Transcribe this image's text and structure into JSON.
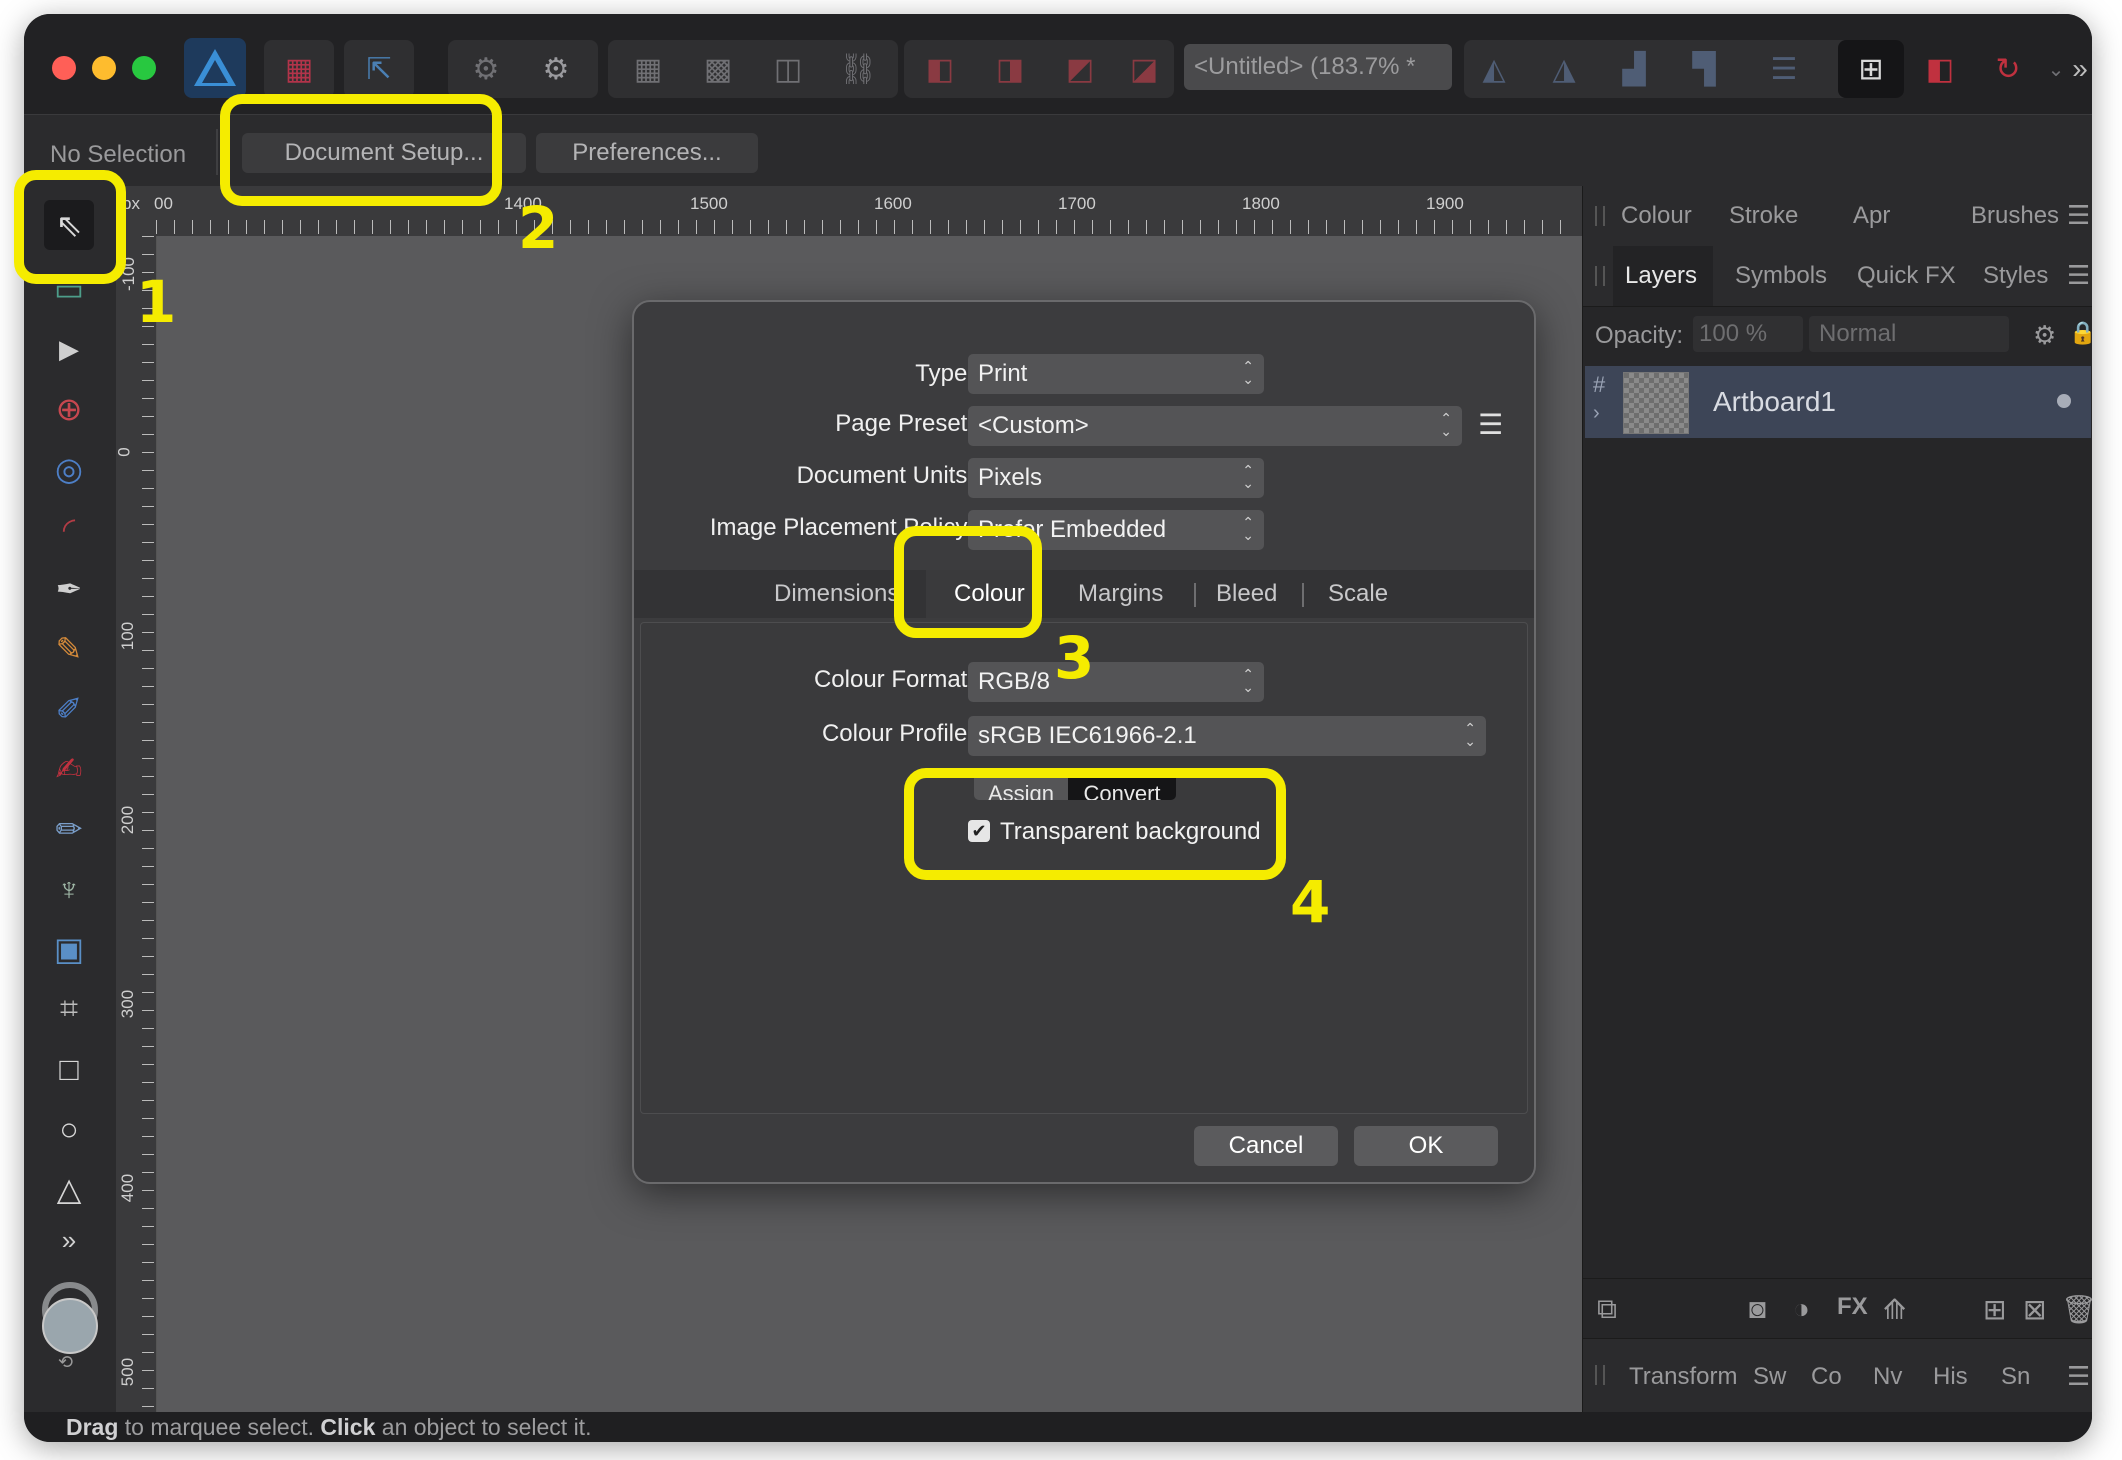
{
  "window": {
    "document_title": "<Untitled> (183.7% *"
  },
  "context_toolbar": {
    "selection_status": "No Selection",
    "document_setup_label": "Document Setup...",
    "preferences_label": "Preferences..."
  },
  "rulers": {
    "unit": "px",
    "horizontal_ticks": [
      "00",
      "1400",
      "1500",
      "1600",
      "1700",
      "1800",
      "1900"
    ],
    "vertical_ticks": [
      "-100",
      "0",
      "100",
      "200",
      "300",
      "400",
      "500"
    ]
  },
  "right_panel": {
    "top_tabs": [
      "Colour",
      "Stroke",
      "Apr",
      "Brushes"
    ],
    "studio_tabs": [
      "Layers",
      "Symbols",
      "Quick FX",
      "Styles"
    ],
    "active_studio_tab": "Layers",
    "opacity_label": "Opacity:",
    "opacity_value": "100 %",
    "blend_mode": "Normal",
    "layer_name": "Artboard1",
    "bottom_tabs": [
      "Transform",
      "Sw",
      "Co",
      "Nv",
      "His",
      "Sn"
    ]
  },
  "dialog": {
    "type_label": "Type:",
    "type_value": "Print",
    "page_preset_label": "Page Preset:",
    "page_preset_value": "<Custom>",
    "document_units_label": "Document Units:",
    "document_units_value": "Pixels",
    "image_placement_label": "Image Placement Policy:",
    "image_placement_value": "Prefer Embedded",
    "tabs": [
      "Dimensions",
      "Colour",
      "Margins",
      "Bleed",
      "Scale"
    ],
    "active_tab": "Colour",
    "colour_format_label": "Colour Format:",
    "colour_format_value": "RGB/8",
    "colour_profile_label": "Colour Profile:",
    "colour_profile_value": "sRGB IEC61966-2.1",
    "assign_label": "Assign",
    "convert_label": "Convert",
    "transparent_background_label": "Transparent background",
    "transparent_background_checked": true,
    "cancel_label": "Cancel",
    "ok_label": "OK"
  },
  "annotations": {
    "step1": "1",
    "step2": "2",
    "step3": "3",
    "step4": "4",
    "highlight_color": "#f5ec00"
  },
  "status_bar": {
    "drag_word": "Drag",
    "drag_rest": " to marquee select. ",
    "click_word": "Click",
    "click_rest": " an object to select it."
  }
}
